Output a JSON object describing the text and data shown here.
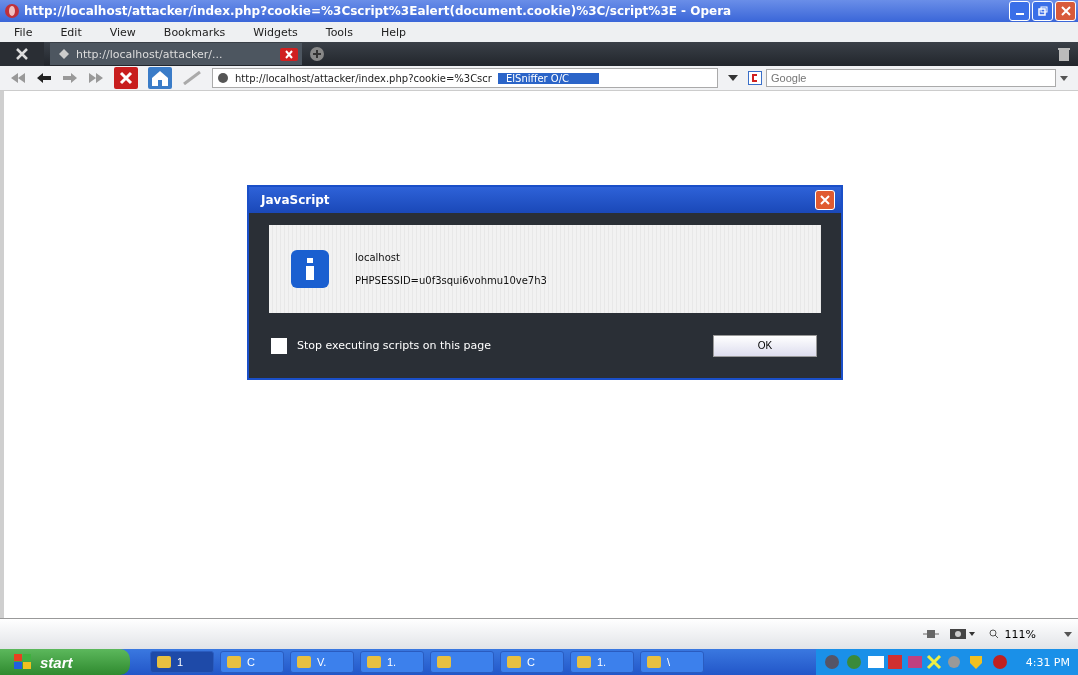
{
  "window": {
    "title": "http://localhost/attacker/index.php?cookie=%3Cscript%3Ealert(document.cookie)%3C/script%3E - Opera"
  },
  "menu": [
    "File",
    "Edit",
    "View",
    "Bookmarks",
    "Widgets",
    "Tools",
    "Help"
  ],
  "tabs": [
    {
      "label": "http://localhost/attacker/...",
      "selected": true
    }
  ],
  "address": {
    "value": "http://localhost/attacker/index.php?cookie=%3Cscr",
    "highlight": "ElSniffer O/C"
  },
  "search": {
    "placeholder": "Google"
  },
  "dialog": {
    "title": "JavaScript",
    "heading": "localhost",
    "message": "PHPSESSID=u0f3squi6vohmu10ve7h3",
    "checkbox": {
      "label": "Stop executing scripts on this page",
      "checked": false
    },
    "button": "OK"
  },
  "status_bar": {
    "zoom": "111%"
  },
  "taskbar": {
    "start": "start",
    "items": [
      {
        "label": "1",
        "selected": true
      },
      {
        "label": "C",
        "selected": false
      },
      {
        "label": "V.",
        "selected": false
      },
      {
        "label": "1.",
        "selected": false
      },
      {
        "selected": false
      },
      {
        "label": "C",
        "selected": false
      },
      {
        "label": "1.",
        "selected": false
      },
      {
        "label": "\\",
        "selected": false
      }
    ],
    "clock": "4:31 PM"
  }
}
